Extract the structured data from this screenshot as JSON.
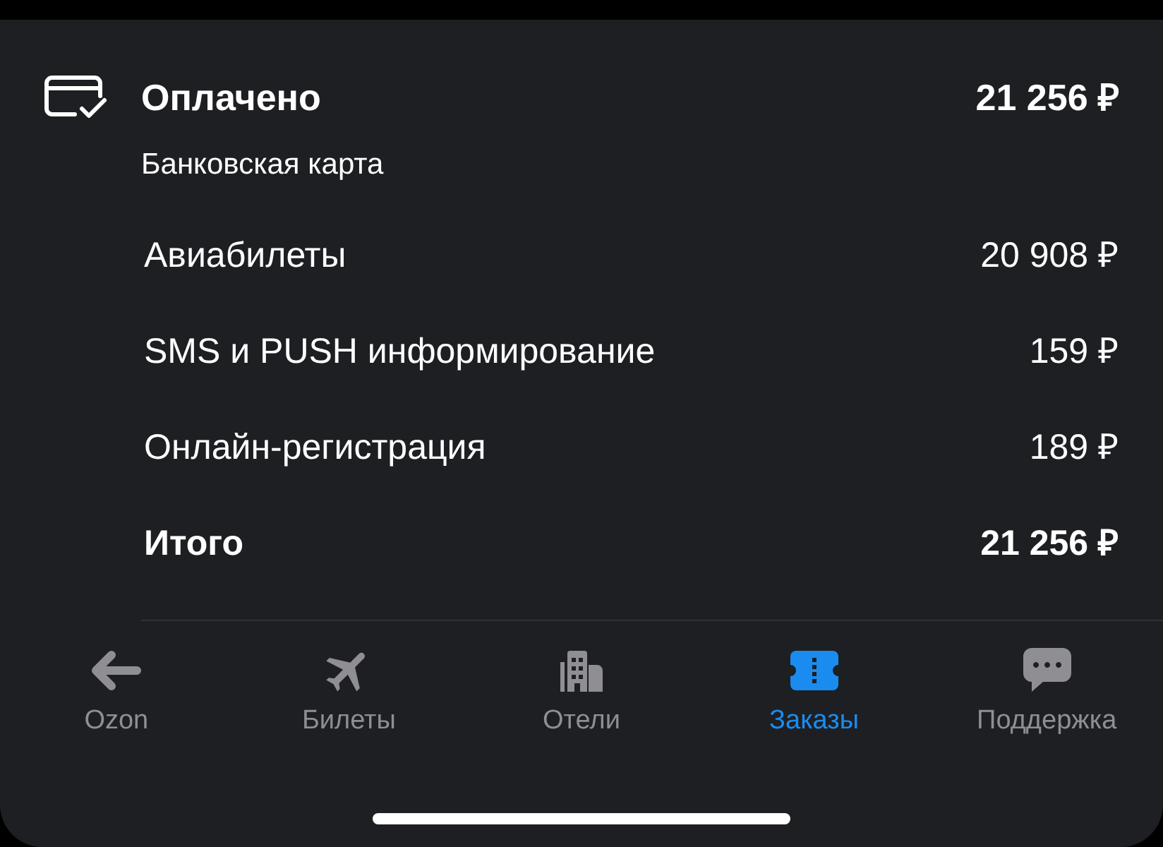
{
  "payment": {
    "title": "Оплачено",
    "amount": "21 256 ₽",
    "method": "Банковская карта"
  },
  "items": [
    {
      "kind": "line",
      "label": "Авиабилеты",
      "amount": "20 908 ₽"
    },
    {
      "kind": "line",
      "label": "SMS и PUSH информирование",
      "amount": "159 ₽"
    },
    {
      "kind": "line",
      "label": "Онлайн-регистрация",
      "amount": "189 ₽"
    },
    {
      "kind": "total",
      "label": "Итого",
      "amount": "21 256 ₽"
    }
  ],
  "tabs": [
    {
      "label": "Ozon",
      "selected": false
    },
    {
      "label": "Билеты",
      "selected": false
    },
    {
      "label": "Отели",
      "selected": false
    },
    {
      "label": "Заказы",
      "selected": true
    },
    {
      "label": "Поддержка",
      "selected": false
    }
  ]
}
